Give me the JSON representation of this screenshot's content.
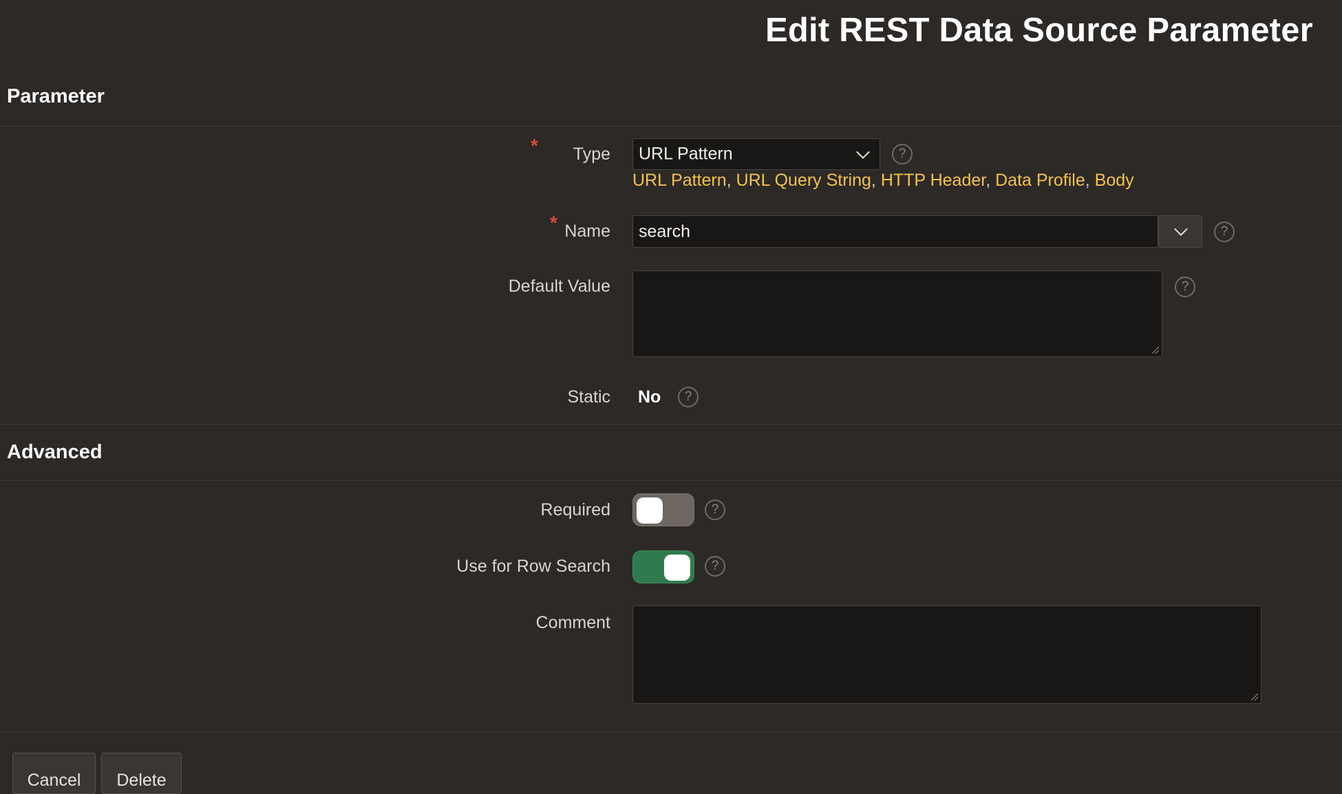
{
  "page": {
    "title": "Edit REST Data Source Parameter"
  },
  "sections": {
    "parameter": "Parameter",
    "advanced": "Advanced"
  },
  "form": {
    "type": {
      "label": "Type",
      "required_marker": "*",
      "value": "URL Pattern",
      "options": [
        "URL Pattern",
        "URL Query String",
        "HTTP Header",
        "Data Profile",
        "Body"
      ],
      "option_separator": ","
    },
    "name": {
      "label": "Name",
      "required_marker": "*",
      "value": "search"
    },
    "default_value": {
      "label": "Default Value",
      "value": ""
    },
    "static": {
      "label": "Static",
      "value": "No"
    },
    "required": {
      "label": "Required",
      "on": false
    },
    "row_search": {
      "label": "Use for Row Search",
      "on": true
    },
    "comment": {
      "label": "Comment",
      "value": ""
    },
    "help_glyph": "?"
  },
  "buttons": {
    "cancel": "Cancel",
    "delete": "Delete"
  },
  "colors": {
    "background": "#2c2927",
    "field_bg": "#181716",
    "option_link": "#f5c24b",
    "required_star": "#d64a3e",
    "toggle_on": "#2f7a4f",
    "toggle_off": "#6d6661"
  },
  "icons": {
    "help": "help-circle-icon",
    "dropdown": "chevron-down-icon",
    "resize": "resize-handle-icon"
  }
}
